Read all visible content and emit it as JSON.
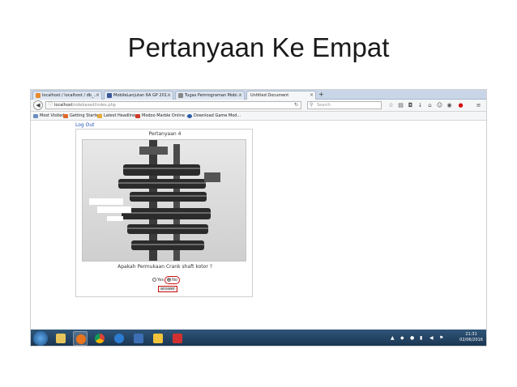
{
  "slide": {
    "title": "Pertanyaan Ke Empat"
  },
  "browser": {
    "tabs": [
      {
        "label": "localhost / localhost / db_...",
        "color": "#e88b2a"
      },
      {
        "label": "MobileLanjutan 6A GP 201...",
        "color": "#3b5998"
      },
      {
        "label": "Tugas Pemrograman Mobi...",
        "color": "#888888"
      },
      {
        "label": "Untitled Document",
        "color": ""
      }
    ],
    "new_tab": "+",
    "url_host": "localhost",
    "url_path": "/sidebased/index.php",
    "search_placeholder": "Search",
    "bookmarks": [
      {
        "label": "Most Visited",
        "color": "#6a8fc0"
      },
      {
        "label": "Getting Started",
        "color": "#e0692a"
      },
      {
        "label": "Latest Headlines",
        "color": "#e8a93a"
      },
      {
        "label": "Modoo Marble Online ...",
        "color": "#d23d2b"
      },
      {
        "label": "Download Game Mod...",
        "color": "#2a5fa8"
      }
    ]
  },
  "page": {
    "logout": "Log Out",
    "card_title": "Pertanyaan 4",
    "question": "Apakah Permukaan Crank shaft kotor ?",
    "options": {
      "yes": "Yes",
      "no": "No",
      "selected": "No"
    },
    "answer_button": "answer"
  },
  "taskbar": {
    "clock_time": "21:31",
    "clock_date": "02/06/2016"
  },
  "colors": {
    "highlight": "#d01010",
    "taskbar": "#1f3d5e",
    "link": "#2255bb"
  }
}
